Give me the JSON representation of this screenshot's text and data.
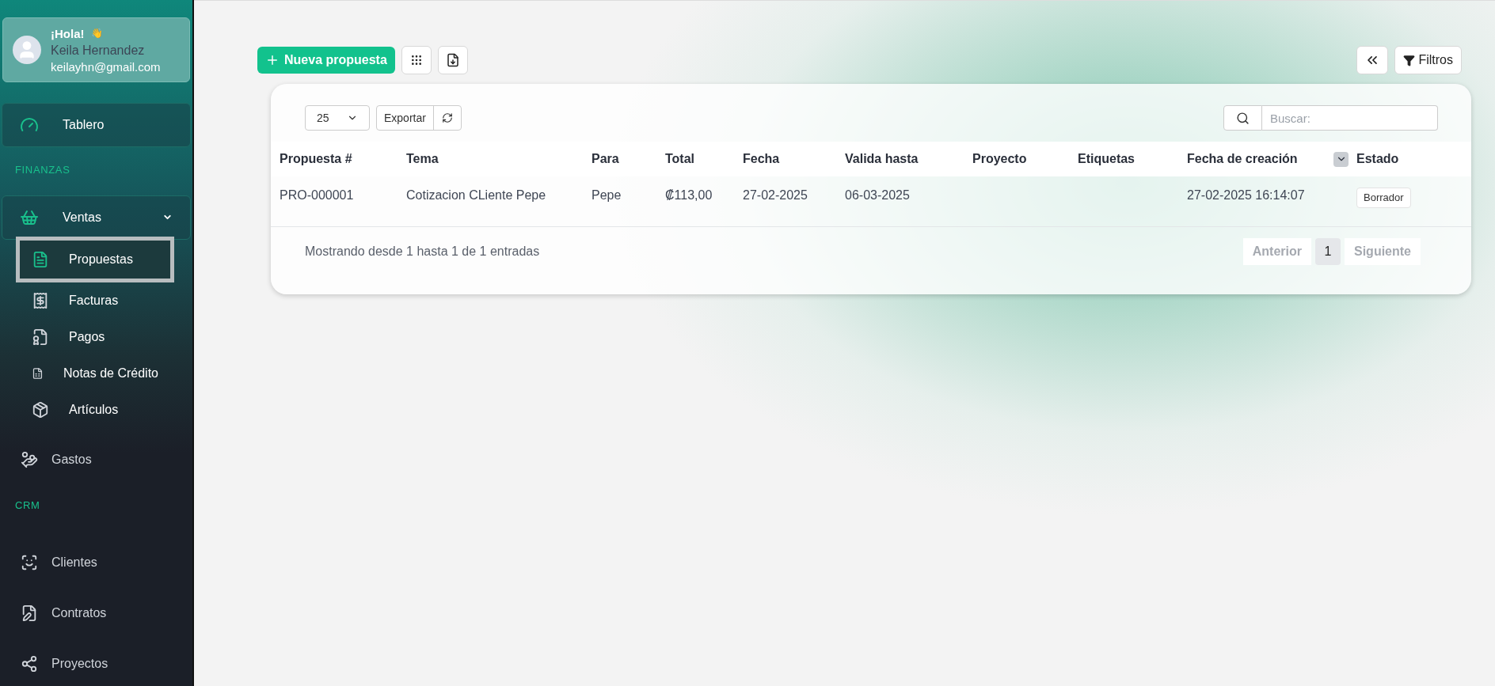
{
  "sidebar": {
    "profile": {
      "greeting": "¡Hola!",
      "wave": "👋",
      "name": "Keila Hernandez",
      "email": "keilayhn@gmail.com"
    },
    "items": [
      {
        "kind": "boxed",
        "label": "Tablero",
        "selected": false
      },
      {
        "kind": "header",
        "label": "FINANZAS"
      },
      {
        "kind": "group",
        "label": "Ventas",
        "expanded": true,
        "children": [
          {
            "label": "Propuestas",
            "selected": true
          },
          {
            "label": "Facturas",
            "selected": false
          },
          {
            "label": "Pagos",
            "selected": false
          },
          {
            "label": "Notas de Crédito",
            "selected": false
          },
          {
            "label": "Artículos",
            "selected": false
          }
        ]
      },
      {
        "kind": "plain",
        "label": "Gastos",
        "selected": false
      },
      {
        "kind": "header",
        "label": "CRM"
      },
      {
        "kind": "plain",
        "label": "Clientes",
        "selected": false
      },
      {
        "kind": "plain",
        "label": "Contratos",
        "selected": false
      },
      {
        "kind": "plain",
        "label": "Proyectos",
        "selected": false
      }
    ]
  },
  "toolbar": {
    "new_button": "Nueva propuesta",
    "filters_button": "Filtros"
  },
  "table_controls": {
    "page_size": "25",
    "export_button": "Exportar",
    "search": {
      "placeholder": "Buscar:"
    }
  },
  "table": {
    "columns": [
      "Propuesta #",
      "Tema",
      "Para",
      "Total",
      "Fecha",
      "Valida hasta",
      "Proyecto",
      "Etiquetas",
      "Fecha de creación",
      "Estado"
    ],
    "rows": [
      {
        "cells": [
          "PRO-000001",
          "Cotizacion CLiente Pepe",
          "Pepe",
          "₡113,00",
          "27-02-2025",
          "06-03-2025",
          "",
          "",
          "27-02-2025 16:14:07"
        ],
        "status": "Borrador"
      }
    ]
  },
  "footer": {
    "summary": "Mostrando desde 1 hasta 1 de 1 entradas",
    "pagination": [
      {
        "label": "Anterior",
        "kind": "nav",
        "disabled": true
      },
      {
        "label": "1",
        "kind": "page",
        "selected": true
      },
      {
        "label": "Siguiente",
        "kind": "nav",
        "disabled": true
      }
    ]
  }
}
